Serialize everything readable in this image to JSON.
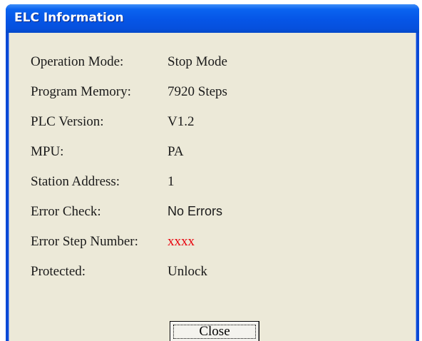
{
  "window": {
    "title": "ELC Information"
  },
  "info": {
    "operation_mode": {
      "label": "Operation Mode:",
      "value": "Stop Mode"
    },
    "program_memory": {
      "label": "Program Memory:",
      "value": "7920 Steps"
    },
    "plc_version": {
      "label": "PLC Version:",
      "value": "V1.2"
    },
    "mpu": {
      "label": "MPU:",
      "value": "PA"
    },
    "station_address": {
      "label": "Station Address:",
      "value": "1"
    },
    "error_check": {
      "label": "Error Check:",
      "value": "No Errors"
    },
    "error_step_number": {
      "label": "Error Step Number:",
      "value": "xxxx",
      "color": "#e8000b"
    },
    "protected": {
      "label": "Protected:",
      "value": "Unlock"
    }
  },
  "buttons": {
    "close_label": "Close"
  },
  "colors": {
    "title_bar": "#0655e6",
    "dialog_background": "#ece9d8",
    "error_value": "#e8000b"
  }
}
